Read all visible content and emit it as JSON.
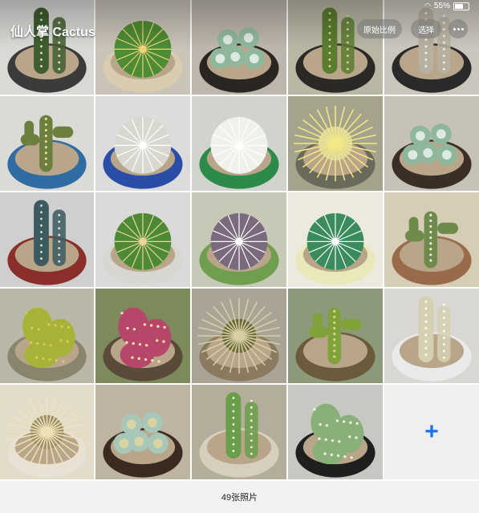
{
  "album": {
    "title": "仙人掌 Cactus"
  },
  "toolbar": {
    "original_ratio_label": "原始比例",
    "select_label": "选择"
  },
  "status": {
    "battery": "55%"
  },
  "footer": {
    "photo_count": "49张照片"
  },
  "add_button": {
    "label": "+"
  },
  "photos": [
    {
      "bg": "#d9d9d6",
      "pot": "#3b3b3b",
      "plant": "#3f5d2f",
      "spine": "#e8e2c2",
      "shape": "column"
    },
    {
      "bg": "#c9c3b8",
      "pot": "#d8cbb0",
      "plant": "#4d8b34",
      "spine": "#f2d27a",
      "shape": "ball"
    },
    {
      "bg": "#bdb6ac",
      "pot": "#2a2520",
      "plant": "#8fb79b",
      "spine": "#ffffff",
      "shape": "rosette"
    },
    {
      "bg": "#b9b6a4",
      "pot": "#2b2926",
      "plant": "#5a7c2f",
      "spine": "#d8d2a0",
      "shape": "column"
    },
    {
      "bg": "#cbc6bd",
      "pot": "#2a2a2a",
      "plant": "#b8b0a0",
      "spine": "#eeeeee",
      "shape": "column"
    },
    {
      "bg": "#dadad6",
      "pot": "#2e6ca3",
      "plant": "#6d7f3e",
      "spine": "#ecdfa5",
      "shape": "branch"
    },
    {
      "bg": "#dcdcdc",
      "pot": "#2a4ea8",
      "plant": "#d8d8d0",
      "spine": "#ffffff",
      "shape": "ball"
    },
    {
      "bg": "#d0d4cc",
      "pot": "#2c8a4a",
      "plant": "#f1f1ec",
      "spine": "#ffffff",
      "shape": "ball"
    },
    {
      "bg": "#a6a38d",
      "pot": "#6a6a5a",
      "plant": "#d9d59c",
      "spine": "#f3e887",
      "shape": "spiky"
    },
    {
      "bg": "#c6c2b8",
      "pot": "#3a2e26",
      "plant": "#8fb79b",
      "spine": "#ffffff",
      "shape": "rosette"
    },
    {
      "bg": "#cfcfcf",
      "pot": "#8b2f2a",
      "plant": "#3b5b5f",
      "spine": "#e0e0e0",
      "shape": "column"
    },
    {
      "bg": "#dadada",
      "pot": "#d8d6d0",
      "plant": "#4e8a36",
      "spine": "#ead79e",
      "shape": "ball"
    },
    {
      "bg": "#c5c9b6",
      "pot": "#6e9e4e",
      "plant": "#7b6a7e",
      "spine": "#ffffff",
      "shape": "ball"
    },
    {
      "bg": "#eceadf",
      "pot": "#e9e8b9",
      "plant": "#3a8c5c",
      "spine": "#ffffff",
      "shape": "ball"
    },
    {
      "bg": "#d6cdb7",
      "pot": "#9a6b4a",
      "plant": "#6f8b4b",
      "spine": "#f0f0f0",
      "shape": "branch"
    },
    {
      "bg": "#bab7a6",
      "pot": "#88846d",
      "plant": "#a6b338",
      "spine": "#d7c95c",
      "shape": "pads"
    },
    {
      "bg": "#7c8a5c",
      "pot": "#5a4a3a",
      "plant": "#b7466b",
      "spine": "#f2e3b0",
      "shape": "pads"
    },
    {
      "bg": "#a9a496",
      "pot": "#8a7a60",
      "plant": "#6c6a3a",
      "spine": "#d8cfa5",
      "shape": "spiky"
    },
    {
      "bg": "#8c9a7b",
      "pot": "#6b5a3b",
      "plant": "#7fa33a",
      "spine": "#e8d68f",
      "shape": "branch"
    },
    {
      "bg": "#d8d7d3",
      "pot": "#eaeaea",
      "plant": "#d5d0b2",
      "spine": "#ffffff",
      "shape": "column"
    },
    {
      "bg": "#e3dccb",
      "pot": "#e8e2d6",
      "plant": "#9c8f68",
      "spine": "#eee2b6",
      "shape": "spiky"
    },
    {
      "bg": "#bdb5a2",
      "pot": "#3a2a1f",
      "plant": "#a7c7b8",
      "spine": "#f2d99a",
      "shape": "rosette"
    },
    {
      "bg": "#b3ad9c",
      "pot": "#d6cfbd",
      "plant": "#6a9e4a",
      "spine": "#f2f2e0",
      "shape": "column"
    },
    {
      "bg": "#c7c7c3",
      "pot": "#1f1f1f",
      "plant": "#8ab07a",
      "spine": "#f0f0e0",
      "shape": "pads"
    }
  ]
}
